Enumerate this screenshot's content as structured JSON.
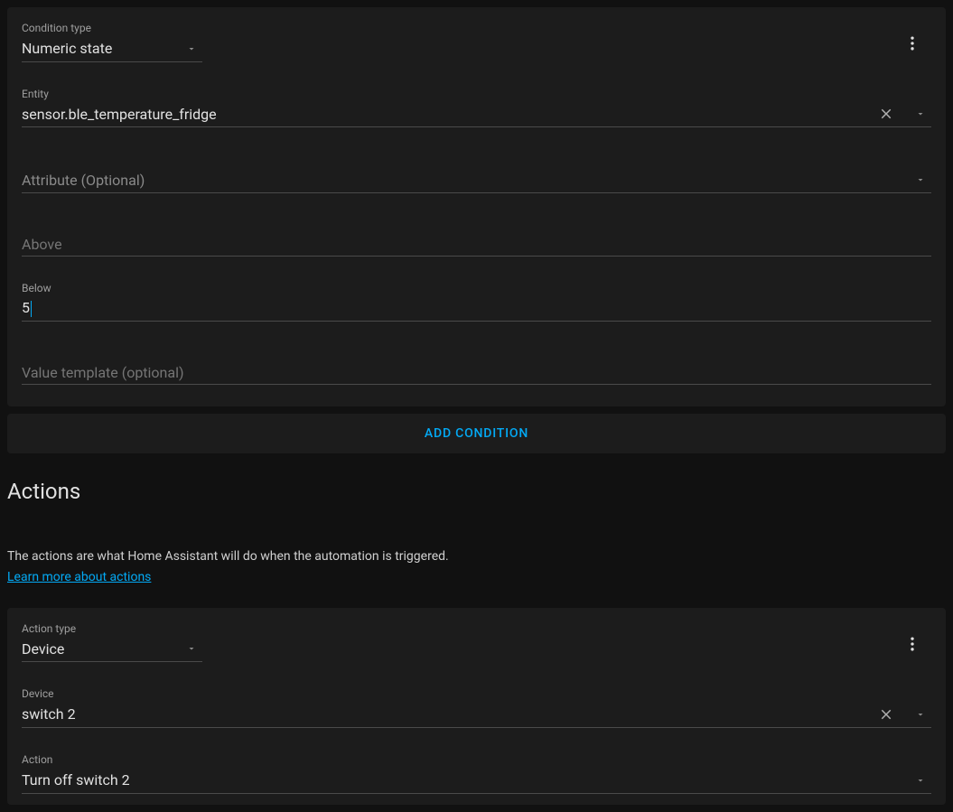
{
  "condition_card": {
    "condition_type_label": "Condition type",
    "condition_type_value": "Numeric state",
    "entity_label": "Entity",
    "entity_value": "sensor.ble_temperature_fridge",
    "attribute_placeholder": "Attribute (Optional)",
    "attribute_value": "",
    "above_placeholder": "Above",
    "above_value": "",
    "below_label": "Below",
    "below_value": "5",
    "value_template_placeholder": "Value template (optional)",
    "value_template_value": ""
  },
  "add_condition_label": "ADD CONDITION",
  "actions_section": {
    "title": "Actions",
    "description": "The actions are what Home Assistant will do when the automation is triggered.",
    "learn_more": "Learn more about actions"
  },
  "action_card": {
    "action_type_label": "Action type",
    "action_type_value": "Device",
    "device_label": "Device",
    "device_value": "switch 2",
    "action_label": "Action",
    "action_value": "Turn off switch 2"
  }
}
